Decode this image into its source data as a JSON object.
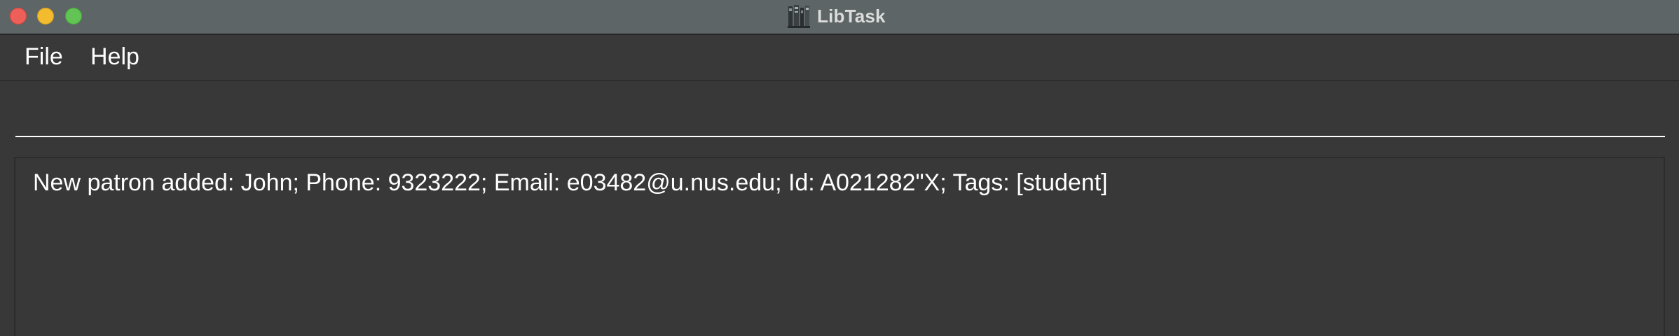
{
  "window": {
    "title": "LibTask",
    "app_icon": "bookshelf-icon",
    "controls": [
      "close",
      "minimize",
      "zoom"
    ],
    "colors": {
      "titlebar": "#5e6566",
      "close": "#ee5f5a",
      "minimize": "#f2bc2e",
      "zoom": "#61c454",
      "background": "#383838",
      "text": "#ffffff"
    }
  },
  "menubar": {
    "items": [
      {
        "label": "File"
      },
      {
        "label": "Help"
      }
    ]
  },
  "command": {
    "value": "",
    "placeholder": ""
  },
  "result": {
    "message": "New patron added: John; Phone: 9323222; Email: e03482@u.nus.edu; Id: A021282\"X; Tags: [student]"
  }
}
